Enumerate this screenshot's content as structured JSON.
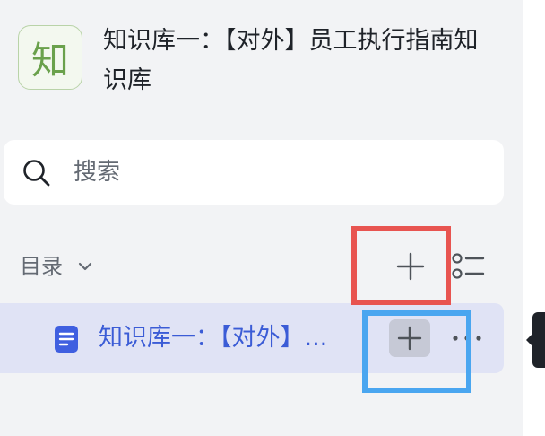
{
  "knowledge_base": {
    "logo_char": "知",
    "title": "知识库一：【对外】员工执行指南知识库"
  },
  "search": {
    "placeholder": "搜索"
  },
  "directory": {
    "label": "目录"
  },
  "tree": {
    "items": [
      {
        "label": "知识库一：【对外】..."
      }
    ]
  },
  "colors": {
    "highlight_red": "#e85450",
    "highlight_blue": "#4aa6f0",
    "selected_bg": "#e0e3f5",
    "selected_text": "#3b5cd6"
  }
}
